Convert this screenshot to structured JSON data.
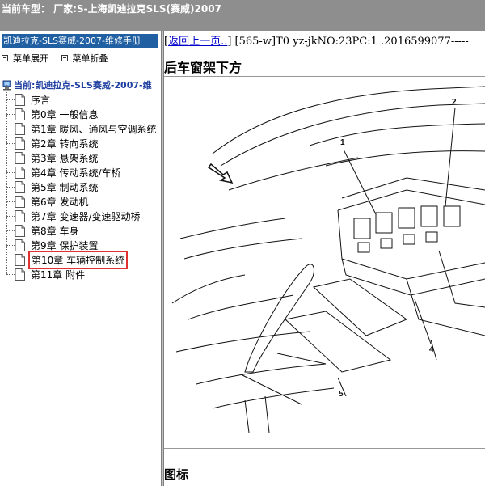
{
  "window": {
    "title": "当前车型： 厂家:S-上海凯迪拉克SLS(赛威)2007"
  },
  "sidebar": {
    "manual_title": "凯迪拉克-SLS赛威-2007-维修手册",
    "expand_label": "菜单展开",
    "collapse_label": "菜单折叠",
    "root_label": "当前:凯迪拉克-SLS赛威-2007-维",
    "items": [
      {
        "label": "序言"
      },
      {
        "label": "第0章 一般信息"
      },
      {
        "label": "第1章 暖风、通风与空调系统"
      },
      {
        "label": "第2章 转向系统"
      },
      {
        "label": "第3章 悬架系统"
      },
      {
        "label": "第4章 传动系统/车桥"
      },
      {
        "label": "第5章 制动系统"
      },
      {
        "label": "第6章 发动机"
      },
      {
        "label": "第7章 变速器/变速驱动桥"
      },
      {
        "label": "第8章 车身"
      },
      {
        "label": "第9章 保护装置"
      },
      {
        "label": "第10章 车辆控制系统",
        "selected": true
      },
      {
        "label": "第11章 附件"
      }
    ]
  },
  "content": {
    "back_link": "返回上一页..",
    "breadcrumb_rest": "] [565-w]T0 yz-jkNO:23PC:1 .2016599077-----",
    "bracket_open": "[",
    "heading": "后车窗架下方",
    "figure": {
      "callouts": [
        "1",
        "2",
        "4",
        "5"
      ]
    },
    "legend_title": "图标"
  },
  "colors": {
    "topbar": "#8e8e8e",
    "manual_header": "#1f5fa2",
    "selection_outline": "#e03030",
    "link": "#0000cc"
  }
}
